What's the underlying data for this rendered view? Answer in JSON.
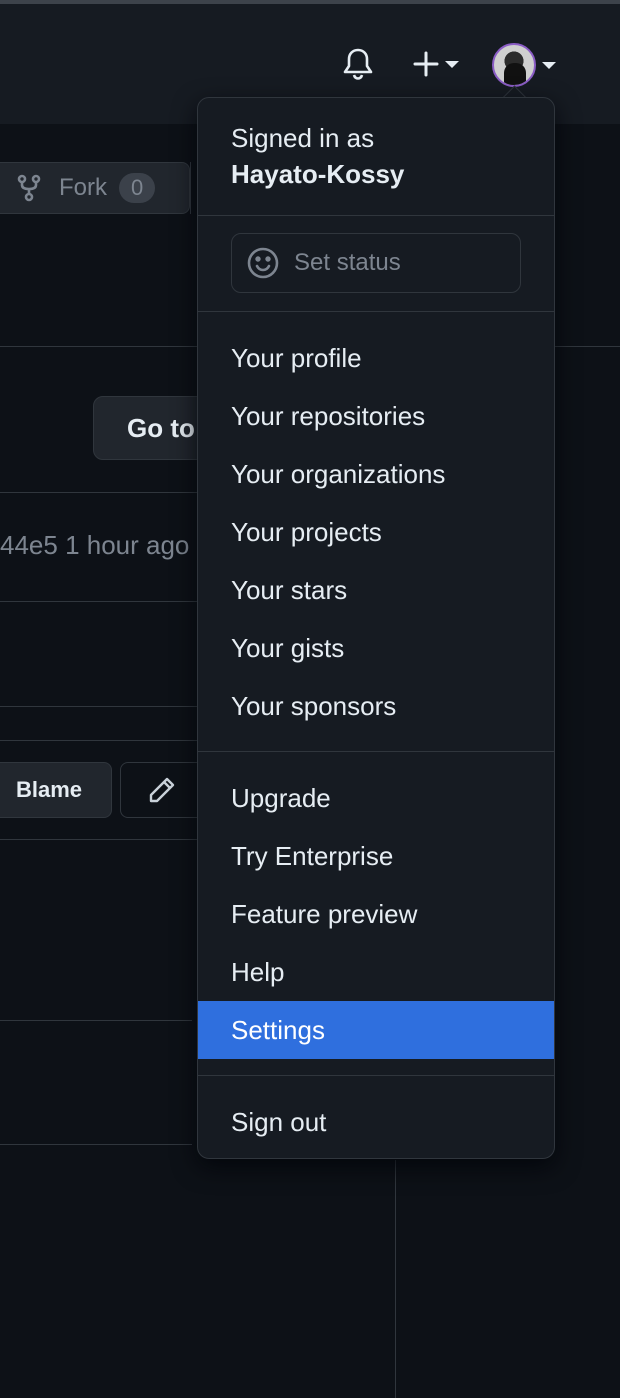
{
  "header": {
    "bell_icon": "bell-icon",
    "create_icon": "plus-icon",
    "avatar_icon": "avatar"
  },
  "background": {
    "fork_label": "Fork",
    "fork_count": "0",
    "goto_label": "Go to",
    "commit_text": "44e5 1 hour ago",
    "blame_label": "Blame"
  },
  "dropdown": {
    "signed_in_label": "Signed in as",
    "username": "Hayato-Kossy",
    "set_status": "Set status",
    "group1": [
      "Your profile",
      "Your repositories",
      "Your organizations",
      "Your projects",
      "Your stars",
      "Your gists",
      "Your sponsors"
    ],
    "group2": [
      "Upgrade",
      "Try Enterprise",
      "Feature preview",
      "Help",
      "Settings"
    ],
    "group3": [
      "Sign out"
    ],
    "active_item": "Settings",
    "active_color": "#2f6fde"
  }
}
